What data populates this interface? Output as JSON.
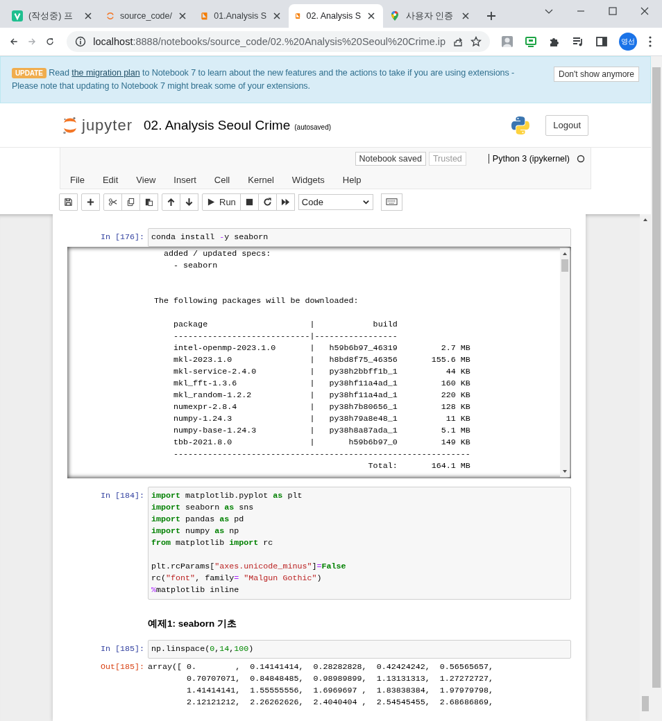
{
  "browser": {
    "tabs": [
      {
        "title": "(작성중) 프",
        "kind": "vmark",
        "selected": false
      },
      {
        "title": "source_code/",
        "kind": "ring",
        "selected": false
      },
      {
        "title": "01.Analysis S",
        "kind": "book",
        "selected": false
      },
      {
        "title": "02. Analysis S",
        "kind": "book",
        "selected": true
      },
      {
        "title": "사용자 인증",
        "kind": "pin",
        "selected": false
      }
    ],
    "address": {
      "host": "localhost",
      "path": ":8888/notebooks/source_code/02.%20Analysis%20Seoul%20Crime.ip"
    },
    "profile": "영선"
  },
  "banner": {
    "badge": "UPDATE",
    "before": "Read ",
    "link": "the migration plan",
    "after": " to Notebook 7 to learn about the new features and the actions to take if you are using extensions - Please note that updating to Notebook 7 might break some of your extensions.",
    "button": "Don't show anymore"
  },
  "header": {
    "logo_text": "jupyter",
    "title": "02. Analysis Seoul Crime",
    "save_status": "(autosaved)",
    "logout": "Logout"
  },
  "status": {
    "notebook_saved": {
      "label": "Notebook saved",
      "disabled": false
    },
    "trusted": {
      "label": "Trusted",
      "disabled": true
    },
    "kernel": "Python 3 (ipykernel)",
    "kernel_busy": false
  },
  "menu": [
    "File",
    "Edit",
    "View",
    "Insert",
    "Cell",
    "Kernel",
    "Widgets",
    "Help"
  ],
  "toolbar": {
    "groups": [
      [
        {
          "kind": "save"
        }
      ],
      [
        {
          "kind": "insert"
        }
      ],
      [
        {
          "kind": "cut"
        },
        {
          "kind": "copy"
        },
        {
          "kind": "paste"
        }
      ],
      [
        {
          "kind": "up"
        },
        {
          "kind": "down"
        }
      ],
      [
        {
          "kind": "run",
          "label": "Run"
        },
        {
          "kind": "stop"
        },
        {
          "kind": "restart"
        },
        {
          "kind": "restart_run"
        }
      ]
    ],
    "cell_type": "Code"
  },
  "cells": [
    {
      "kind": "code",
      "prompt": "In [176]:",
      "lines": [
        {
          "kind": "code",
          "tokens": [
            {
              "kind": "plain",
              "text": "conda install "
            },
            {
              "kind": "op",
              "text": "-"
            },
            {
              "kind": "plain",
              "text": "y seaborn"
            }
          ]
        }
      ],
      "output": {
        "kind": "scrolled",
        "lines": [
          {
            "kind": "text",
            "text": "  added / updated specs:"
          },
          {
            "kind": "text",
            "text": "    - seaborn"
          },
          {
            "kind": "blank"
          },
          {
            "kind": "blank"
          },
          {
            "kind": "text",
            "text": "The following packages will be downloaded:"
          },
          {
            "kind": "blank"
          },
          {
            "kind": "text",
            "text": "    package                     |            build"
          },
          {
            "kind": "text",
            "text": "    ----------------------------|-----------------"
          },
          {
            "kind": "text",
            "text": "    intel-openmp-2023.1.0       |   h59b6b97_46319         2.7 MB"
          },
          {
            "kind": "text",
            "text": "    mkl-2023.1.0                |   h8bd8f75_46356       155.6 MB"
          },
          {
            "kind": "text",
            "text": "    mkl-service-2.4.0           |   py38h2bbff1b_1          44 KB"
          },
          {
            "kind": "text",
            "text": "    mkl_fft-1.3.6               |   py38hf11a4ad_1         160 KB"
          },
          {
            "kind": "text",
            "text": "    mkl_random-1.2.2            |   py38hf11a4ad_1         220 KB"
          },
          {
            "kind": "text",
            "text": "    numexpr-2.8.4               |   py38h7b80656_1         128 KB"
          },
          {
            "kind": "text",
            "text": "    numpy-1.24.3                |   py38h79a8e48_1          11 KB"
          },
          {
            "kind": "text",
            "text": "    numpy-base-1.24.3           |   py38h8a87ada_1         5.1 MB"
          },
          {
            "kind": "text",
            "text": "    tbb-2021.8.0                |       h59b6b97_0         149 KB"
          },
          {
            "kind": "text",
            "text": "    -------------------------------------------------------------"
          },
          {
            "kind": "text",
            "text": "                                            Total:       164.1 MB"
          }
        ]
      }
    },
    {
      "kind": "code",
      "prompt": "In [184]:",
      "lines": [
        {
          "kind": "code",
          "tokens": [
            {
              "kind": "kw",
              "text": "import"
            },
            {
              "kind": "plain",
              "text": " matplotlib.pyplot "
            },
            {
              "kind": "kw",
              "text": "as"
            },
            {
              "kind": "plain",
              "text": " plt"
            }
          ]
        },
        {
          "kind": "code",
          "tokens": [
            {
              "kind": "kw",
              "text": "import"
            },
            {
              "kind": "plain",
              "text": " seaborn "
            },
            {
              "kind": "kw",
              "text": "as"
            },
            {
              "kind": "plain",
              "text": " sns"
            }
          ]
        },
        {
          "kind": "code",
          "tokens": [
            {
              "kind": "kw",
              "text": "import"
            },
            {
              "kind": "plain",
              "text": " pandas "
            },
            {
              "kind": "kw",
              "text": "as"
            },
            {
              "kind": "plain",
              "text": " pd"
            }
          ]
        },
        {
          "kind": "code",
          "tokens": [
            {
              "kind": "kw",
              "text": "import"
            },
            {
              "kind": "plain",
              "text": " numpy "
            },
            {
              "kind": "kw",
              "text": "as"
            },
            {
              "kind": "plain",
              "text": " np"
            }
          ]
        },
        {
          "kind": "code",
          "tokens": [
            {
              "kind": "kw",
              "text": "from"
            },
            {
              "kind": "plain",
              "text": " matplotlib "
            },
            {
              "kind": "kw",
              "text": "import"
            },
            {
              "kind": "plain",
              "text": " rc"
            }
          ]
        },
        {
          "kind": "blank"
        },
        {
          "kind": "code",
          "tokens": [
            {
              "kind": "plain",
              "text": "plt.rcParams["
            },
            {
              "kind": "str",
              "text": "\"axes.unicode_minus\""
            },
            {
              "kind": "plain",
              "text": "]"
            },
            {
              "kind": "op",
              "text": "="
            },
            {
              "kind": "kw",
              "text": "False"
            }
          ]
        },
        {
          "kind": "code",
          "tokens": [
            {
              "kind": "plain",
              "text": "rc("
            },
            {
              "kind": "str",
              "text": "\"font\""
            },
            {
              "kind": "plain",
              "text": ", family"
            },
            {
              "kind": "op",
              "text": "= "
            },
            {
              "kind": "str",
              "text": "\"Malgun Gothic\""
            },
            {
              "kind": "plain",
              "text": ")"
            }
          ]
        },
        {
          "kind": "code",
          "tokens": [
            {
              "kind": "magic",
              "text": "%"
            },
            {
              "kind": "plain",
              "text": "matplotlib inline"
            }
          ]
        }
      ]
    },
    {
      "kind": "markdown",
      "heading": "예제1: seaborn 기초"
    },
    {
      "kind": "code",
      "prompt": "In [185]:",
      "lines": [
        {
          "kind": "code",
          "tokens": [
            {
              "kind": "plain",
              "text": "np.linspace("
            },
            {
              "kind": "num",
              "text": "0"
            },
            {
              "kind": "plain",
              "text": ","
            },
            {
              "kind": "num",
              "text": "14"
            },
            {
              "kind": "plain",
              "text": ","
            },
            {
              "kind": "num",
              "text": "100"
            },
            {
              "kind": "plain",
              "text": ")"
            }
          ]
        }
      ],
      "output": {
        "kind": "result",
        "prompt": "Out[185]:",
        "lines": [
          {
            "kind": "text",
            "text": "array([ 0.        ,  0.14141414,  0.28282828,  0.42424242,  0.56565657,"
          },
          {
            "kind": "text",
            "text": "        0.70707071,  0.84848485,  0.98989899,  1.13131313,  1.27272727,"
          },
          {
            "kind": "text",
            "text": "        1.41414141,  1.55555556,  1.6969697 ,  1.83838384,  1.97979798,"
          },
          {
            "kind": "text",
            "text": "        2.12121212,  2.26262626,  2.4040404 ,  2.54545455,  2.68686869,"
          }
        ]
      }
    }
  ]
}
